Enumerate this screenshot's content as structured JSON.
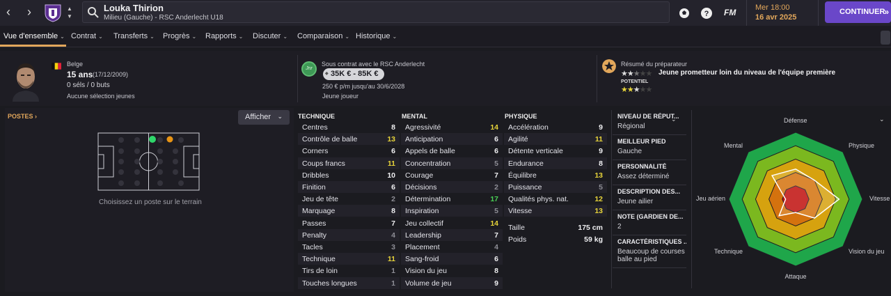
{
  "topbar": {
    "player_name": "Louka Thirion",
    "player_sub": "Milieu (Gauche) - RSC Anderlecht U18",
    "fm_label": "FM",
    "time": "Mer 18:00",
    "date": "16 avr 2025",
    "continue_label": "CONTINUER",
    "icons": [
      "back-arrow",
      "forward-arrow",
      "club-crest",
      "up-down-chevrons",
      "search",
      "football-icon",
      "help-icon"
    ]
  },
  "menu": [
    {
      "label": "Vue d'ensemble",
      "active": true
    },
    {
      "label": "Contrat"
    },
    {
      "label": "Transferts"
    },
    {
      "label": "Progrès"
    },
    {
      "label": "Rapports"
    },
    {
      "label": "Discuter"
    },
    {
      "label": "Comparaison"
    },
    {
      "label": "Historique"
    }
  ],
  "info": {
    "nationality": "Belge",
    "age": "15 ans",
    "dob": "(17/12/2009)",
    "apps": "0 séls / 0 buts",
    "youth": "Aucune sélection jeunes",
    "contract_title": "Sous contrat avec le RSC Anderlecht",
    "contract_badge": "Jnr",
    "value": "35K € - 85K €",
    "wage": "250 € p/m jusqu'au 30/6/2028",
    "player_type": "Jeune joueur",
    "scout_title": "Résumé du préparateur",
    "scout_summary": "Jeune prometteur loin du niveau de l'équipe première",
    "potential_label": "POTENTIEL",
    "current_stars": 2.5,
    "potential_stars": 3
  },
  "positions": {
    "title": "POSTES",
    "show_button": "Afficher",
    "hint": "Choisissez un poste sur le terrain"
  },
  "technique": {
    "title": "TECHNIQUE",
    "rows": [
      {
        "label": "Centres",
        "value": "8",
        "c": "w"
      },
      {
        "label": "Contrôle de balle",
        "value": "13",
        "c": "y"
      },
      {
        "label": "Corners",
        "value": "6",
        "c": "w"
      },
      {
        "label": "Coups francs",
        "value": "11",
        "c": "y"
      },
      {
        "label": "Dribbles",
        "value": "10",
        "c": "w"
      },
      {
        "label": "Finition",
        "value": "6",
        "c": "w"
      },
      {
        "label": "Jeu de tête",
        "value": "2",
        "c": "g"
      },
      {
        "label": "Marquage",
        "value": "8",
        "c": "w"
      },
      {
        "label": "Passes",
        "value": "7",
        "c": "w"
      },
      {
        "label": "Penalty",
        "value": "4",
        "c": "g"
      },
      {
        "label": "Tacles",
        "value": "3",
        "c": "g"
      },
      {
        "label": "Technique",
        "value": "11",
        "c": "y"
      },
      {
        "label": "Tirs de loin",
        "value": "1",
        "c": "g"
      },
      {
        "label": "Touches longues",
        "value": "1",
        "c": "g"
      }
    ]
  },
  "mental": {
    "title": "MENTAL",
    "rows": [
      {
        "label": "Agressivité",
        "value": "14",
        "c": "y"
      },
      {
        "label": "Anticipation",
        "value": "6",
        "c": "w"
      },
      {
        "label": "Appels de balle",
        "value": "6",
        "c": "w"
      },
      {
        "label": "Concentration",
        "value": "5",
        "c": "g"
      },
      {
        "label": "Courage",
        "value": "7",
        "c": "w"
      },
      {
        "label": "Décisions",
        "value": "2",
        "c": "g"
      },
      {
        "label": "Détermination",
        "value": "17",
        "c": "gr"
      },
      {
        "label": "Inspiration",
        "value": "5",
        "c": "g"
      },
      {
        "label": "Jeu collectif",
        "value": "14",
        "c": "y"
      },
      {
        "label": "Leadership",
        "value": "7",
        "c": "w"
      },
      {
        "label": "Placement",
        "value": "4",
        "c": "g"
      },
      {
        "label": "Sang-froid",
        "value": "6",
        "c": "w"
      },
      {
        "label": "Vision du jeu",
        "value": "8",
        "c": "w"
      },
      {
        "label": "Volume de jeu",
        "value": "9",
        "c": "w"
      }
    ]
  },
  "physique": {
    "title": "PHYSIQUE",
    "rows": [
      {
        "label": "Accélération",
        "value": "9",
        "c": "w"
      },
      {
        "label": "Agilité",
        "value": "11",
        "c": "y"
      },
      {
        "label": "Détente verticale",
        "value": "9",
        "c": "w"
      },
      {
        "label": "Endurance",
        "value": "8",
        "c": "w"
      },
      {
        "label": "Équilibre",
        "value": "13",
        "c": "y"
      },
      {
        "label": "Puissance",
        "value": "5",
        "c": "g"
      },
      {
        "label": "Qualités phys. nat.",
        "value": "12",
        "c": "y"
      },
      {
        "label": "Vitesse",
        "value": "13",
        "c": "y"
      }
    ],
    "extra": [
      {
        "label": "Taille",
        "value": "175 cm"
      },
      {
        "label": "Poids",
        "value": "59 kg"
      }
    ]
  },
  "details": [
    {
      "head": "NIVEAU DE RÉPUT...",
      "value": "Régional"
    },
    {
      "head": "MEILLEUR PIED",
      "value": "Gauche"
    },
    {
      "head": "PERSONNALITÉ",
      "value": "Assez déterminé"
    },
    {
      "head": "DESCRIPTION DES...",
      "value": "Jeune ailier"
    },
    {
      "head": "NOTE (GARDIEN DE...",
      "value": "2"
    },
    {
      "head": "CARACTÉRISTIQUES ...",
      "value": "Beaucoup de courses balle au pied"
    }
  ],
  "radar": {
    "labels": [
      "Défense",
      "Physique",
      "Vitesse",
      "Vision du jeu",
      "Attaque",
      "Technique",
      "Jeu aérien",
      "Mental"
    ],
    "values": [
      9,
      8,
      13,
      8,
      4,
      7,
      3,
      10
    ],
    "max": 20
  },
  "colors": {
    "accent": "#e2a75b",
    "continue": "#6a47c9",
    "yellow": "#e8d53a",
    "green": "#49d155"
  }
}
